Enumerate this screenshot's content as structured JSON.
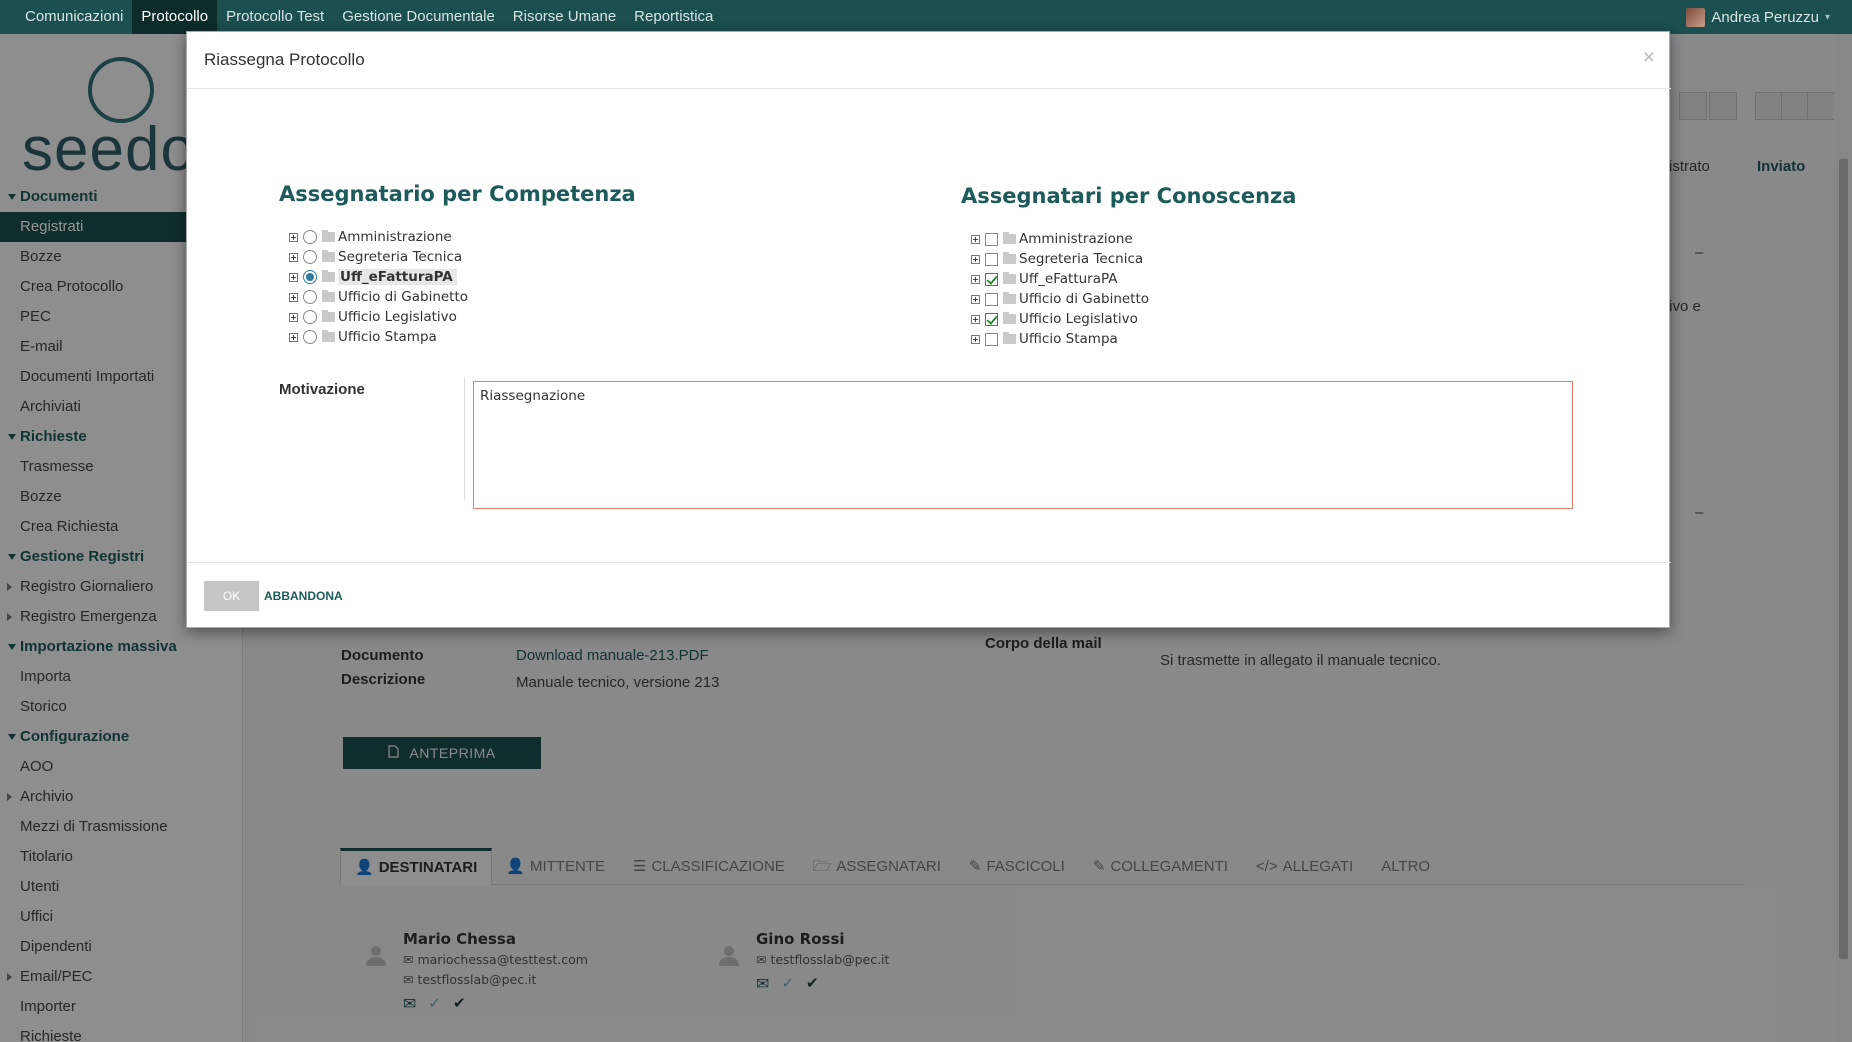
{
  "topnav": {
    "items": [
      "Comunicazioni",
      "Protocollo",
      "Protocollo Test",
      "Gestione Documentale",
      "Risorse Umane",
      "Reportistica"
    ],
    "active": "Protocollo",
    "user": "Andrea Peruzzu"
  },
  "logo": {
    "text": "seedo"
  },
  "sidebar": {
    "sections": [
      {
        "title": "Documenti",
        "items": [
          "Registrati",
          "Bozze",
          "Crea Protocollo",
          "PEC",
          "E-mail",
          "Documenti Importati",
          "Archiviati"
        ]
      },
      {
        "title": "Richieste",
        "items": [
          "Trasmesse",
          "Bozze",
          "Crea Richiesta"
        ]
      },
      {
        "title": "Gestione Registri",
        "items": [
          "Registro Giornaliero",
          "Registro Emergenza"
        ]
      },
      {
        "title": "Importazione massiva",
        "items": [
          "Importa",
          "Storico"
        ]
      },
      {
        "title": "Configurazione",
        "items": [
          "AOO",
          "Archivio",
          "Mezzi di Trasmissione",
          "Titolario",
          "Utenti",
          "Uffici",
          "Dipendenti",
          "Email/PEC",
          "Importer",
          "Richieste"
        ]
      }
    ]
  },
  "background": {
    "status_partial": "istrato",
    "status_sent": "Inviato",
    "dash1": "–",
    "dash2": "–",
    "partial_text": "tivo e",
    "documento_label": "Documento",
    "documento_value": "Download manuale-213.PDF",
    "descrizione_label": "Descrizione",
    "descrizione_value": "Manuale tecnico, versione 213",
    "corpo_label": "Corpo della mail",
    "corpo_value": "Si trasmette in allegato il manuale tecnico.",
    "preview_button": "ANTEPRIMA",
    "tabs": [
      "DESTINATARI",
      "MITTENTE",
      "CLASSIFICAZIONE",
      "ASSEGNATARI",
      "FASCICOLI",
      "COLLEGAMENTI",
      "ALLEGATI",
      "ALTRO"
    ],
    "recipients": [
      {
        "name": "Mario Chessa",
        "email1": "mariochessa@testtest.com",
        "email2": "testflosslab@pec.it"
      },
      {
        "name": "Gino Rossi",
        "email1": "testflosslab@pec.it"
      }
    ]
  },
  "modal": {
    "title": "Riassegna Protocollo",
    "close": "×",
    "competenza_title": "Assegnatario per Competenza",
    "competenza": [
      {
        "label": "Amministrazione",
        "selected": false
      },
      {
        "label": "Segreteria Tecnica",
        "selected": false
      },
      {
        "label": "Uff_eFatturaPA",
        "selected": true
      },
      {
        "label": "Ufficio di Gabinetto",
        "selected": false
      },
      {
        "label": "Ufficio Legislativo",
        "selected": false
      },
      {
        "label": "Ufficio Stampa",
        "selected": false
      }
    ],
    "conoscenza_title": "Assegnatari per Conoscenza",
    "conoscenza": [
      {
        "label": "Amministrazione",
        "checked": false
      },
      {
        "label": "Segreteria Tecnica",
        "checked": false
      },
      {
        "label": "Uff_eFatturaPA",
        "checked": true
      },
      {
        "label": "Ufficio di Gabinetto",
        "checked": false
      },
      {
        "label": "Ufficio Legislativo",
        "checked": true
      },
      {
        "label": "Ufficio Stampa",
        "checked": false
      }
    ],
    "motivazione_label": "Motivazione",
    "motivazione_value": "Riassegnazione",
    "ok_button": "OK",
    "cancel_button": "ABBANDONA"
  },
  "colors": {
    "brand": "#1c4f4f",
    "accent_title": "#1d5a5a",
    "radio_on": "#2f7d9c",
    "check_on": "#2e8a2e",
    "textarea_border": "#e07f6f"
  }
}
